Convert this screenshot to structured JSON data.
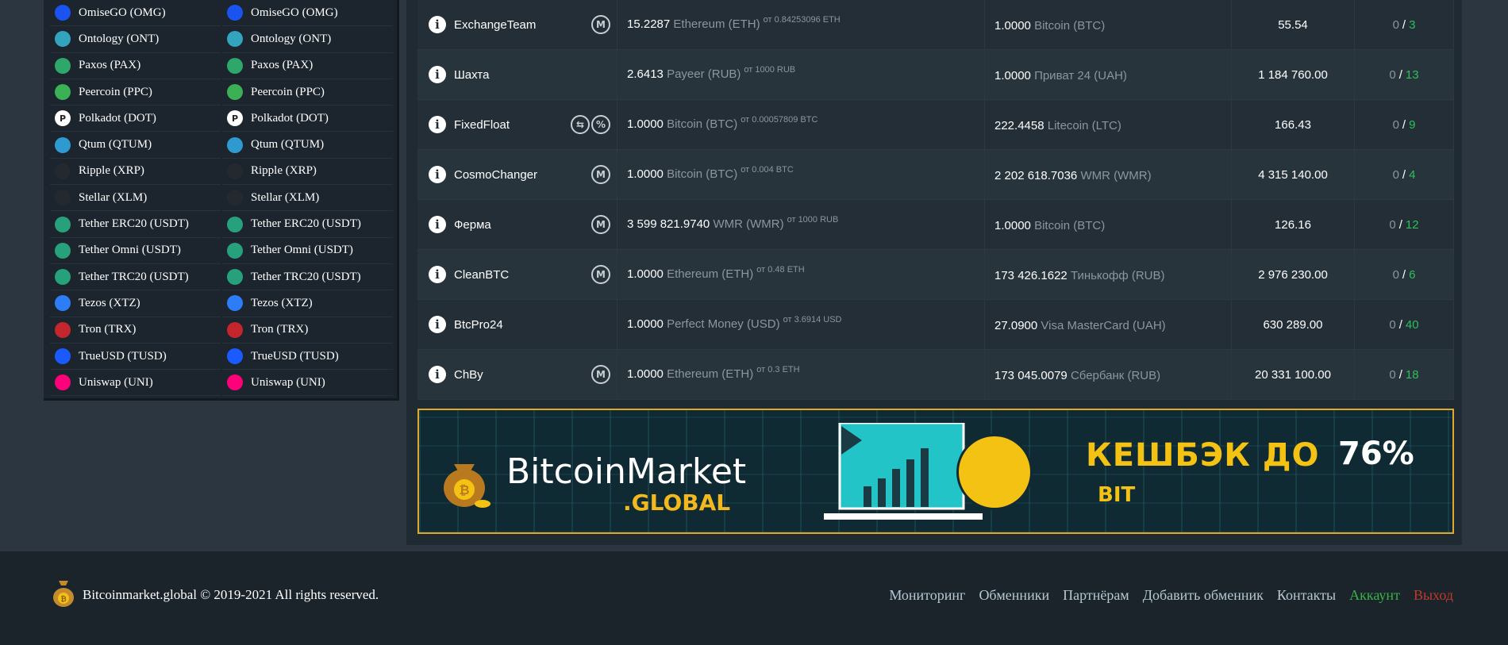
{
  "currencies": [
    {
      "label": "OmiseGO (OMG)",
      "icon": "omisego-icon",
      "color": "#1a53f0"
    },
    {
      "label": "Ontology (ONT)",
      "icon": "ontology-icon",
      "color": "#32a4be"
    },
    {
      "label": "Paxos (PAX)",
      "icon": "paxos-icon",
      "color": "#2ea76a"
    },
    {
      "label": "Peercoin (PPC)",
      "icon": "peercoin-icon",
      "color": "#3cb054"
    },
    {
      "label": "Polkadot (DOT)",
      "icon": "polkadot-icon",
      "color": "#ffffff"
    },
    {
      "label": "Qtum (QTUM)",
      "icon": "qtum-icon",
      "color": "#2e9ad0"
    },
    {
      "label": "Ripple (XRP)",
      "icon": "ripple-icon",
      "color": "#23292f"
    },
    {
      "label": "Stellar (XLM)",
      "icon": "stellar-icon",
      "color": "#23292f"
    },
    {
      "label": "Tether ERC20 (USDT)",
      "icon": "tether-icon",
      "color": "#26a17b"
    },
    {
      "label": "Tether Omni (USDT)",
      "icon": "tether-icon",
      "color": "#26a17b"
    },
    {
      "label": "Tether TRC20 (USDT)",
      "icon": "tether-icon",
      "color": "#26a17b"
    },
    {
      "label": "Tezos (XTZ)",
      "icon": "tezos-icon",
      "color": "#2c7df7"
    },
    {
      "label": "Tron (TRX)",
      "icon": "tron-icon",
      "color": "#c4262e"
    },
    {
      "label": "TrueUSD (TUSD)",
      "icon": "trueusd-icon",
      "color": "#1a5aff"
    },
    {
      "label": "Uniswap (UNI)",
      "icon": "uniswap-icon",
      "color": "#ff007a"
    }
  ],
  "rows": [
    {
      "name": "ExchangeTeam",
      "badges": [
        "M"
      ],
      "give_amt": "15.2287",
      "give_cur": "Ethereum (ETH)",
      "give_min": "от 0.84253096 ETH",
      "get_amt": "1.0000",
      "get_cur": "Bitcoin (BTC)",
      "reserve": "55.54",
      "rev_neg": "0",
      "rev_pos": "3"
    },
    {
      "name": "Шахта",
      "badges": [],
      "give_amt": "2.6413",
      "give_cur": "Payeer (RUB)",
      "give_min": "от 1000 RUB",
      "get_amt": "1.0000",
      "get_cur": "Приват 24 (UAH)",
      "reserve": "1 184 760.00",
      "rev_neg": "0",
      "rev_pos": "13"
    },
    {
      "name": "FixedFloat",
      "badges": [
        "⇆",
        "%"
      ],
      "give_amt": "1.0000",
      "give_cur": "Bitcoin (BTC)",
      "give_min": "от 0.00057809 BTC",
      "get_amt": "222.4458",
      "get_cur": "Litecoin (LTC)",
      "reserve": "166.43",
      "rev_neg": "0",
      "rev_pos": "9"
    },
    {
      "name": "CosmoChanger",
      "badges": [
        "M"
      ],
      "give_amt": "1.0000",
      "give_cur": "Bitcoin (BTC)",
      "give_min": "от 0.004 BTC",
      "get_amt": "2 202 618.7036",
      "get_cur": "WMR (WMR)",
      "reserve": "4 315 140.00",
      "rev_neg": "0",
      "rev_pos": "4"
    },
    {
      "name": "Ферма",
      "badges": [
        "M"
      ],
      "give_amt": "3 599 821.9740",
      "give_cur": "WMR (WMR)",
      "give_min": "от 1000 RUB",
      "get_amt": "1.0000",
      "get_cur": "Bitcoin (BTC)",
      "reserve": "126.16",
      "rev_neg": "0",
      "rev_pos": "12"
    },
    {
      "name": "CleanBTC",
      "badges": [
        "M"
      ],
      "give_amt": "1.0000",
      "give_cur": "Ethereum (ETH)",
      "give_min": "от 0.48 ETH",
      "get_amt": "173 426.1622",
      "get_cur": "Тинькофф (RUB)",
      "reserve": "2 976 230.00",
      "rev_neg": "0",
      "rev_pos": "6"
    },
    {
      "name": "BtcPro24",
      "badges": [],
      "give_amt": "1.0000",
      "give_cur": "Perfect Money (USD)",
      "give_min": "от 3.6914 USD",
      "get_amt": "27.0900",
      "get_cur": "Visa MasterCard (UAH)",
      "reserve": "630 289.00",
      "rev_neg": "0",
      "rev_pos": "40"
    },
    {
      "name": "ChBy",
      "badges": [
        "M"
      ],
      "give_amt": "1.0000",
      "give_cur": "Ethereum (ETH)",
      "give_min": "от 0.3 ETH",
      "get_amt": "173 045.0079",
      "get_cur": "Сбербанк (RUB)",
      "reserve": "20 331 100.00",
      "rev_neg": "0",
      "rev_pos": "18"
    }
  ],
  "banner": {
    "brand_main": "BitcoinMarket",
    "brand_sub": ".GLOBAL",
    "cashback": "КЕШБЭК ДО",
    "cashback_pct": "76%",
    "bit": "BIT"
  },
  "footer": {
    "copyright": "Bitcoinmarket.global © 2019-2021 All rights reserved.",
    "nav": [
      {
        "label": "Мониторинг",
        "style": "normal"
      },
      {
        "label": "Обменники",
        "style": "normal"
      },
      {
        "label": "Партнёрам",
        "style": "normal"
      },
      {
        "label": "Добавить обменник",
        "style": "normal"
      },
      {
        "label": "Контакты",
        "style": "normal"
      },
      {
        "label": "Аккаунт",
        "style": "green"
      },
      {
        "label": "Выход",
        "style": "red"
      }
    ]
  },
  "colors": {
    "accent_gold": "#f4c212",
    "positive": "#2dbf5c",
    "logout": "#c0392b"
  }
}
